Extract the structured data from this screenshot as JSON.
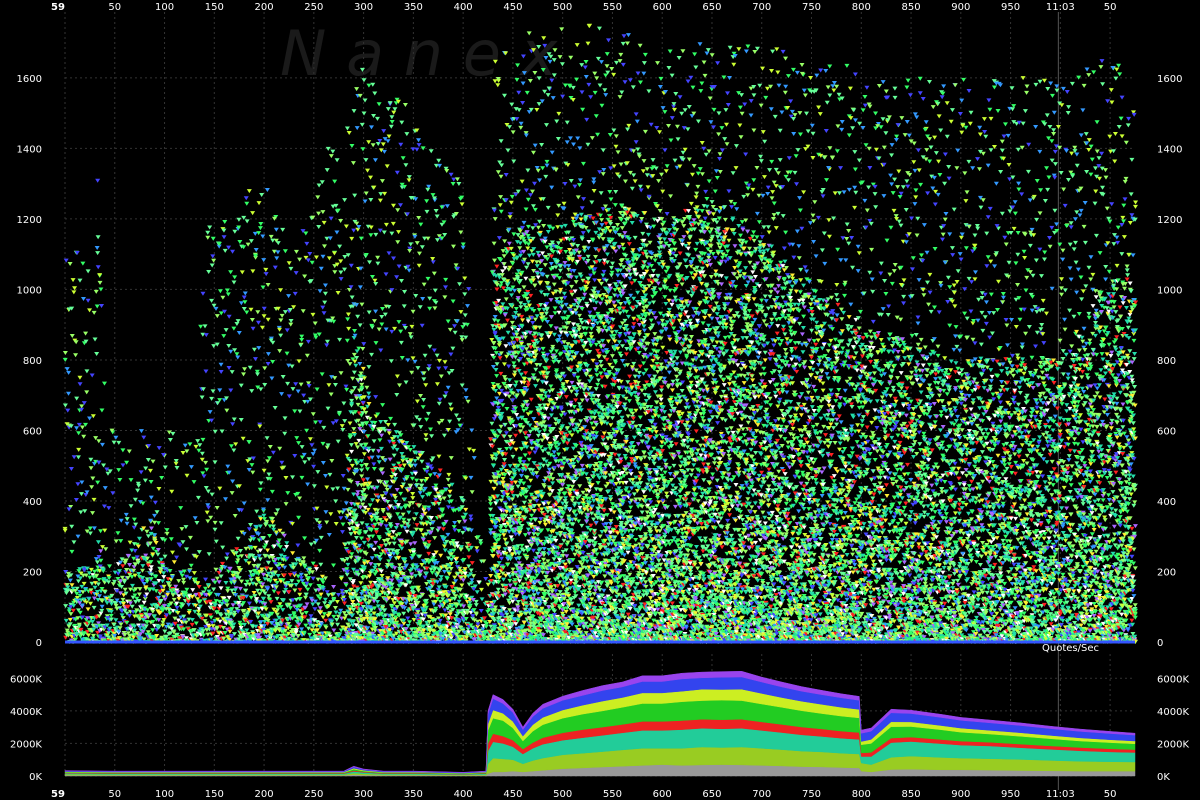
{
  "watermark": "N a n e x",
  "chart_data": [
    {
      "type": "scatter",
      "title": "",
      "xlabel": "",
      "ylabel": "",
      "x_ticks": [
        "59",
        "50",
        "100",
        "150",
        "200",
        "250",
        "300",
        "350",
        "400",
        "450",
        "500",
        "550",
        "600",
        "650",
        "700",
        "750",
        "800",
        "850",
        "900",
        "950",
        "11:03",
        "50"
      ],
      "x_tick_values": [
        0,
        50,
        100,
        150,
        200,
        250,
        300,
        350,
        400,
        450,
        500,
        550,
        600,
        650,
        700,
        750,
        800,
        850,
        900,
        950,
        1000,
        1050
      ],
      "xlim": [
        0,
        1075
      ],
      "ylim": [
        0,
        1750
      ],
      "y_ticks": [
        0,
        200,
        400,
        600,
        800,
        1000,
        1200,
        1400,
        1600
      ],
      "grid": true,
      "colors": [
        "#33ff66",
        "#66ff99",
        "#99ff66",
        "#ccff33",
        "#ffee33",
        "#3399ff",
        "#4444ff",
        "#ff2222",
        "#aa66ff",
        "#22ddaa",
        "#ffffff"
      ],
      "density_profile": {
        "x": [
          0,
          30,
          32,
          40,
          50,
          85,
          100,
          130,
          140,
          175,
          180,
          200,
          230,
          260,
          278,
          290,
          310,
          330,
          350,
          400,
          410,
          425,
          430,
          450,
          500,
          550,
          600,
          650,
          700,
          750,
          780,
          800,
          850,
          900,
          950,
          1000,
          1040,
          1060,
          1075
        ],
        "typical_max": [
          200,
          220,
          300,
          200,
          220,
          350,
          250,
          180,
          150,
          300,
          280,
          380,
          260,
          200,
          120,
          900,
          650,
          600,
          560,
          420,
          240,
          100,
          1100,
          1150,
          1200,
          1250,
          1200,
          1250,
          1150,
          1000,
          950,
          900,
          850,
          800,
          820,
          800,
          1000,
          1050,
          1000
        ],
        "sparse_max": [
          1200,
          1000,
          1500,
          600,
          600,
          600,
          600,
          600,
          1200,
          1200,
          1300,
          1300,
          1100,
          1400,
          1400,
          1650,
          1600,
          1550,
          1500,
          1300,
          600,
          200,
          1650,
          1750,
          1750,
          1750,
          1700,
          1700,
          1700,
          1650,
          1650,
          1600,
          1600,
          1600,
          1600,
          1600,
          1650,
          1650,
          1600
        ]
      }
    },
    {
      "type": "area",
      "title": "",
      "ylabel": "Quotes/Sec",
      "x_ticks": [
        "59",
        "50",
        "100",
        "150",
        "200",
        "250",
        "300",
        "350",
        "400",
        "450",
        "500",
        "550",
        "600",
        "650",
        "700",
        "750",
        "800",
        "850",
        "900",
        "950",
        "11:03",
        "50"
      ],
      "x_tick_values": [
        0,
        50,
        100,
        150,
        200,
        250,
        300,
        350,
        400,
        450,
        500,
        550,
        600,
        650,
        700,
        750,
        800,
        850,
        900,
        950,
        1000,
        1050
      ],
      "xlim": [
        0,
        1075
      ],
      "ylim": [
        0,
        7000
      ],
      "y_ticks": [
        "0K",
        "2000K",
        "4000K",
        "6000K"
      ],
      "y_tick_values": [
        0,
        2000,
        4000,
        6000
      ],
      "grid": true,
      "x": [
        0,
        50,
        100,
        150,
        200,
        250,
        280,
        290,
        300,
        320,
        350,
        400,
        423,
        425,
        430,
        440,
        450,
        460,
        470,
        480,
        500,
        520,
        540,
        560,
        580,
        600,
        620,
        640,
        660,
        680,
        700,
        720,
        740,
        760,
        780,
        798,
        800,
        810,
        830,
        850,
        880,
        900,
        930,
        960,
        990,
        1020,
        1050,
        1075
      ],
      "series": [
        {
          "color": "#999999",
          "values": [
            50,
            40,
            40,
            40,
            40,
            40,
            40,
            80,
            60,
            40,
            40,
            30,
            40,
            150,
            250,
            250,
            300,
            250,
            300,
            350,
            450,
            500,
            550,
            600,
            650,
            700,
            650,
            680,
            700,
            680,
            650,
            620,
            580,
            560,
            520,
            500,
            300,
            250,
            400,
            420,
            380,
            380,
            360,
            340,
            320,
            300,
            300,
            300
          ]
        },
        {
          "color": "#99cc22",
          "values": [
            60,
            50,
            50,
            50,
            50,
            50,
            50,
            100,
            80,
            50,
            50,
            40,
            50,
            600,
            850,
            800,
            700,
            500,
            650,
            750,
            850,
            900,
            950,
            1000,
            1050,
            1000,
            1050,
            1100,
            1050,
            1100,
            1050,
            1000,
            950,
            920,
            880,
            850,
            500,
            450,
            750,
            800,
            760,
            720,
            700,
            680,
            640,
            600,
            580,
            560
          ]
        },
        {
          "color": "#22cc99",
          "values": [
            60,
            50,
            50,
            50,
            50,
            50,
            50,
            100,
            80,
            50,
            50,
            40,
            50,
            800,
            1000,
            950,
            800,
            600,
            750,
            850,
            900,
            950,
            1000,
            1050,
            1100,
            1100,
            1150,
            1150,
            1150,
            1150,
            1100,
            1050,
            1000,
            950,
            920,
            900,
            400,
            500,
            900,
            900,
            850,
            800,
            780,
            720,
            680,
            650,
            600,
            580
          ]
        },
        {
          "color": "#ee2222",
          "values": [
            30,
            30,
            30,
            30,
            30,
            30,
            30,
            60,
            40,
            30,
            30,
            20,
            30,
            450,
            500,
            450,
            400,
            300,
            350,
            400,
            450,
            500,
            500,
            520,
            550,
            550,
            560,
            550,
            560,
            550,
            520,
            500,
            480,
            460,
            440,
            420,
            220,
            250,
            280,
            270,
            250,
            240,
            230,
            220,
            210,
            200,
            190,
            180
          ]
        },
        {
          "color": "#22cc22",
          "values": [
            40,
            40,
            40,
            40,
            40,
            40,
            40,
            80,
            50,
            40,
            40,
            30,
            40,
            800,
            950,
            950,
            750,
            500,
            700,
            800,
            900,
            950,
            1000,
            1050,
            1100,
            1100,
            1150,
            1150,
            1200,
            1150,
            1100,
            1050,
            1000,
            950,
            920,
            900,
            500,
            550,
            700,
            650,
            600,
            550,
            500,
            480,
            440,
            400,
            380,
            360
          ]
        },
        {
          "color": "#ccee22",
          "values": [
            30,
            30,
            30,
            30,
            30,
            30,
            30,
            60,
            40,
            30,
            30,
            20,
            30,
            400,
            500,
            450,
            400,
            300,
            400,
            450,
            500,
            550,
            600,
            600,
            650,
            650,
            650,
            700,
            650,
            700,
            650,
            600,
            580,
            560,
            540,
            520,
            200,
            250,
            300,
            280,
            260,
            250,
            230,
            220,
            200,
            190,
            180,
            170
          ]
        },
        {
          "color": "#3344ee",
          "values": [
            40,
            40,
            40,
            40,
            40,
            40,
            40,
            80,
            50,
            40,
            40,
            30,
            40,
            600,
            700,
            600,
            550,
            400,
            500,
            550,
            600,
            600,
            650,
            650,
            700,
            700,
            750,
            700,
            750,
            750,
            700,
            650,
            620,
            600,
            580,
            560,
            500,
            500,
            550,
            520,
            500,
            480,
            460,
            440,
            420,
            400,
            380,
            360
          ]
        },
        {
          "color": "#9944ee",
          "values": [
            20,
            20,
            20,
            20,
            20,
            20,
            20,
            40,
            30,
            20,
            20,
            15,
            20,
            200,
            250,
            250,
            200,
            150,
            200,
            250,
            250,
            300,
            300,
            300,
            350,
            350,
            350,
            350,
            350,
            350,
            300,
            300,
            280,
            260,
            250,
            240,
            200,
            200,
            220,
            200,
            190,
            180,
            170,
            160,
            150,
            140,
            130,
            120
          ]
        }
      ]
    }
  ]
}
